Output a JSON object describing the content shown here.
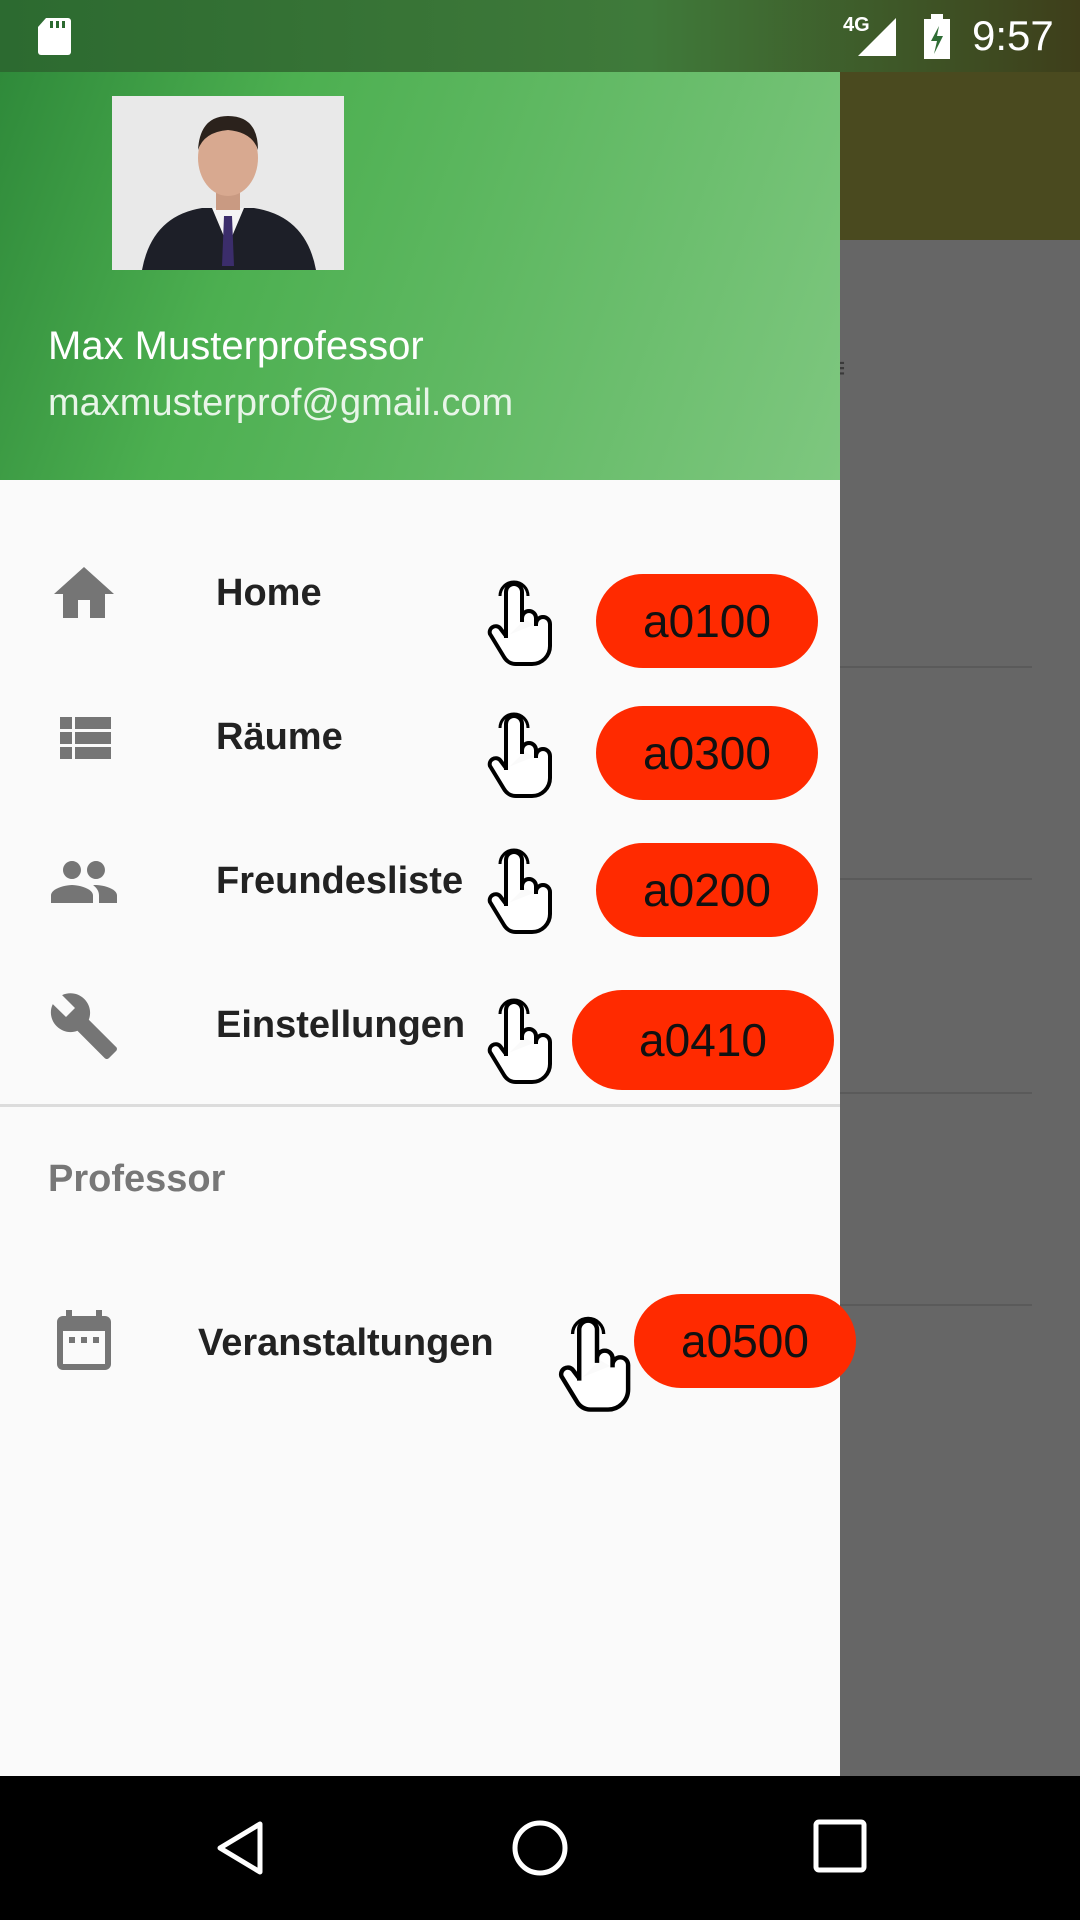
{
  "status_bar": {
    "network": "4G",
    "time": "9:57"
  },
  "drawer": {
    "profile": {
      "name": "Max Musterprofessor",
      "email": "maxmusterprof@gmail.com"
    },
    "items": [
      {
        "label": "Home",
        "icon": "home-icon",
        "annotation": "a0100"
      },
      {
        "label": "Räume",
        "icon": "list-icon",
        "annotation": "a0300"
      },
      {
        "label": "Freundesliste",
        "icon": "people-icon",
        "annotation": "a0200"
      },
      {
        "label": "Einstellungen",
        "icon": "wrench-icon",
        "annotation": "a0410"
      }
    ],
    "section": {
      "title": "Professor",
      "items": [
        {
          "label": "Veranstaltungen",
          "icon": "calendar-icon",
          "annotation": "a0500"
        }
      ]
    }
  },
  "colors": {
    "accent_green": "#4caf50",
    "annotation_red": "#ff2a00",
    "toolbar_olive": "#4a4a1f"
  }
}
